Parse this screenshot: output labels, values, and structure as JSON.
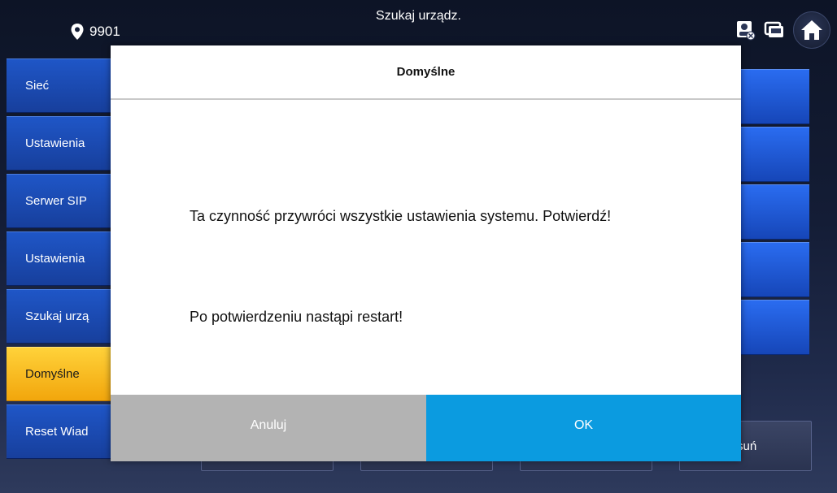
{
  "header": {
    "location_number": "9901",
    "title": "Szukaj urządz."
  },
  "icons": {
    "location": "map-pin-icon",
    "contact": "contact-card-icon",
    "monitor": "monitor-icon",
    "home": "home-icon"
  },
  "sidebar": {
    "items": [
      {
        "label": "Sieć"
      },
      {
        "label": "Ustawienia"
      },
      {
        "label": "Serwer SIP"
      },
      {
        "label": "Ustawienia"
      },
      {
        "label": "Szukaj urzą"
      },
      {
        "label": "Domyślne"
      },
      {
        "label": "Reset Wiad"
      }
    ],
    "active_index": 5
  },
  "bottom_buttons": {
    "delete_partial": "suń"
  },
  "dialog": {
    "title": "Domyślne",
    "message_1": "Ta czynność przywróci wszystkie ustawienia systemu. Potwierdź!",
    "message_2": "Po potwierdzeniu nastąpi restart!",
    "cancel_label": "Anuluj",
    "ok_label": "OK"
  },
  "colors": {
    "sidebar_blue": "#1f56c7",
    "active_yellow": "#f2a60c",
    "ok_blue": "#0b9be0",
    "cancel_grey": "#b3b3b3"
  }
}
